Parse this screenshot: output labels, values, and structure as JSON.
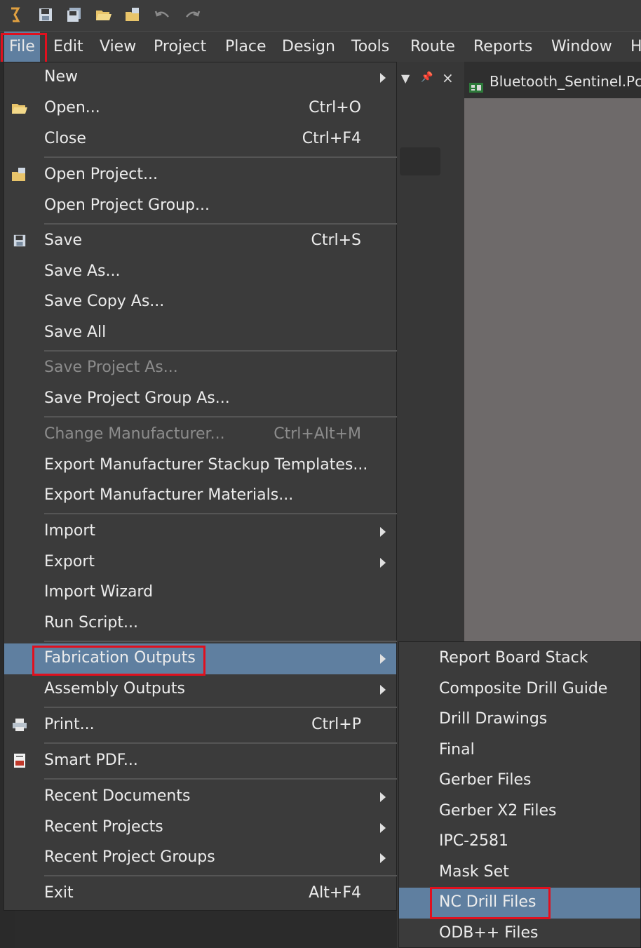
{
  "toolbar": {
    "icons": [
      "app-logo-icon",
      "save-icon",
      "save-all-icon",
      "open-folder-icon",
      "open-project-icon",
      "undo-icon",
      "redo-icon"
    ]
  },
  "menubar": {
    "file": "File",
    "edit": "Edit",
    "view": "View",
    "project": "Project",
    "place": "Place",
    "design": "Design",
    "tools": "Tools",
    "route": "Route",
    "reports": "Reports",
    "window": "Window",
    "help": "H"
  },
  "panel": {
    "dropdown": "▼",
    "pin": "📌",
    "close": "×"
  },
  "doc_tab": {
    "label": "Bluetooth_Sentinel.PcbD"
  },
  "file_menu": {
    "new": "New",
    "open": "Open...",
    "open_shortcut": "Ctrl+O",
    "close": "Close",
    "close_shortcut": "Ctrl+F4",
    "open_project": "Open Project...",
    "open_project_group": "Open Project Group...",
    "save": "Save",
    "save_shortcut": "Ctrl+S",
    "save_as": "Save As...",
    "save_copy_as": "Save Copy As...",
    "save_all": "Save All",
    "save_project_as": "Save Project As...",
    "save_project_group_as": "Save Project Group As...",
    "change_manufacturer": "Change Manufacturer...",
    "change_manufacturer_shortcut": "Ctrl+Alt+M",
    "export_stackup": "Export Manufacturer Stackup Templates...",
    "export_materials": "Export Manufacturer Materials...",
    "import": "Import",
    "export": "Export",
    "import_wizard": "Import Wizard",
    "run_script": "Run Script...",
    "fabrication_outputs": "Fabrication Outputs",
    "assembly_outputs": "Assembly Outputs",
    "print": "Print...",
    "print_shortcut": "Ctrl+P",
    "smart_pdf": "Smart PDF...",
    "recent_documents": "Recent Documents",
    "recent_projects": "Recent Projects",
    "recent_project_groups": "Recent Project Groups",
    "exit": "Exit",
    "exit_shortcut": "Alt+F4"
  },
  "fab_submenu": {
    "report_board_stack": "Report Board Stack",
    "composite_drill_guide": "Composite Drill Guide",
    "drill_drawings": "Drill Drawings",
    "final": "Final",
    "gerber_files": "Gerber Files",
    "gerber_x2_files": "Gerber X2 Files",
    "ipc_2581": "IPC-2581",
    "mask_set": "Mask Set",
    "nc_drill_files": "NC Drill Files",
    "odb_files": "ODB++ Files"
  },
  "colors": {
    "highlight": "#5f7fa0",
    "annotation_box": "#e0101e",
    "menu_bg": "#3b3b3b"
  }
}
